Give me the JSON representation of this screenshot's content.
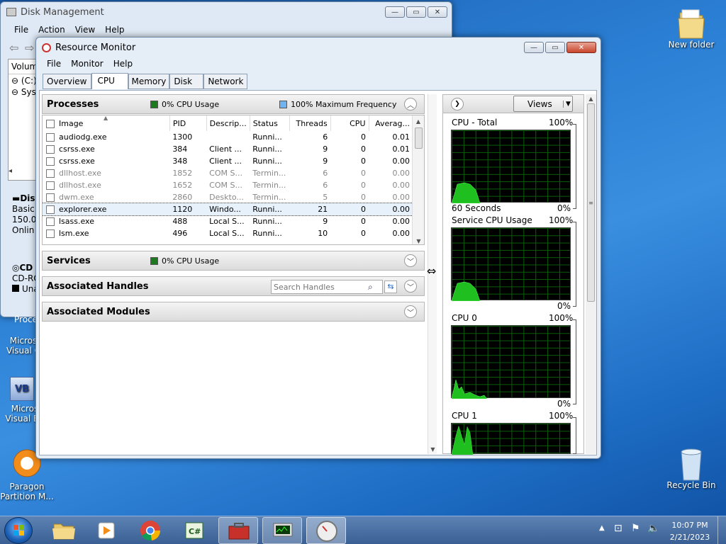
{
  "desktop": {
    "icons": [
      {
        "label": "New folder"
      },
      {
        "label": "Recycle Bin"
      },
      {
        "label": "Micros Visual C"
      },
      {
        "label": "Micros Visual Ba"
      },
      {
        "label": "Paragon Partition M..."
      }
    ]
  },
  "disk_mgmt": {
    "title": "Disk Management",
    "menu": [
      "File",
      "Action",
      "View",
      "Help"
    ],
    "col_volume": "Volum",
    "vol1": "(C:)",
    "vol2": "Syst",
    "disk0_label": "Dis",
    "disk0_type": "Basic",
    "disk0_size": "150.0",
    "disk0_status": "Onlin",
    "cd_label": "CD",
    "cd_type": "CD-RO",
    "unalloc": "Una",
    "proc_fragment": "Proce"
  },
  "resmon": {
    "title": "Resource Monitor",
    "menu": [
      "File",
      "Monitor",
      "Help"
    ],
    "tabs": [
      "Overview",
      "CPU",
      "Memory",
      "Disk",
      "Network"
    ],
    "active_tab": "CPU",
    "processes": {
      "title": "Processes",
      "cpu_usage": "0% CPU Usage",
      "max_freq": "100% Maximum Frequency",
      "columns": [
        "Image",
        "PID",
        "Descrip...",
        "Status",
        "Threads",
        "CPU",
        "Averag..."
      ],
      "rows": [
        {
          "image": "audiodg.exe",
          "pid": "1300",
          "desc": "",
          "status": "Runni...",
          "threads": "6",
          "cpu": "0",
          "avg": "0.01",
          "dim": false,
          "selected": false
        },
        {
          "image": "csrss.exe",
          "pid": "384",
          "desc": "Client ...",
          "status": "Runni...",
          "threads": "9",
          "cpu": "0",
          "avg": "0.01",
          "dim": false,
          "selected": false
        },
        {
          "image": "csrss.exe",
          "pid": "348",
          "desc": "Client ...",
          "status": "Runni...",
          "threads": "9",
          "cpu": "0",
          "avg": "0.00",
          "dim": false,
          "selected": false
        },
        {
          "image": "dllhost.exe",
          "pid": "1852",
          "desc": "COM S...",
          "status": "Termin...",
          "threads": "6",
          "cpu": "0",
          "avg": "0.00",
          "dim": true,
          "selected": false
        },
        {
          "image": "dllhost.exe",
          "pid": "1652",
          "desc": "COM S...",
          "status": "Termin...",
          "threads": "6",
          "cpu": "0",
          "avg": "0.00",
          "dim": true,
          "selected": false
        },
        {
          "image": "dwm.exe",
          "pid": "2860",
          "desc": "Deskto...",
          "status": "Termin...",
          "threads": "5",
          "cpu": "0",
          "avg": "0.00",
          "dim": true,
          "selected": false
        },
        {
          "image": "explorer.exe",
          "pid": "1120",
          "desc": "Windo...",
          "status": "Runni...",
          "threads": "21",
          "cpu": "0",
          "avg": "0.00",
          "dim": false,
          "selected": true
        },
        {
          "image": "lsass.exe",
          "pid": "488",
          "desc": "Local S...",
          "status": "Runni...",
          "threads": "9",
          "cpu": "0",
          "avg": "0.00",
          "dim": false,
          "selected": false
        },
        {
          "image": "lsm.exe",
          "pid": "496",
          "desc": "Local S...",
          "status": "Runni...",
          "threads": "10",
          "cpu": "0",
          "avg": "0.00",
          "dim": false,
          "selected": false
        }
      ]
    },
    "services": {
      "title": "Services",
      "cpu_usage": "0% CPU Usage"
    },
    "handles": {
      "title": "Associated Handles",
      "search_placeholder": "Search Handles"
    },
    "modules": {
      "title": "Associated Modules"
    },
    "right": {
      "views_label": "Views",
      "graphs": [
        {
          "title": "CPU - Total",
          "max": "100%",
          "footer_left": "60 Seconds",
          "footer_right": "0%"
        },
        {
          "title": "Service CPU Usage",
          "max": "100%",
          "footer_left": "",
          "footer_right": "0%"
        },
        {
          "title": "CPU 0",
          "max": "100%",
          "footer_left": "",
          "footer_right": "0%"
        },
        {
          "title": "CPU 1",
          "max": "100%",
          "footer_left": "",
          "footer_right": ""
        }
      ]
    }
  },
  "taskbar": {
    "time": "10:07 PM",
    "date": "2/21/2023"
  },
  "colors": {
    "graph_green": "#1fbf1f",
    "cpu_square": "#1e7a1e",
    "freq_square": "#6fb4f0"
  }
}
